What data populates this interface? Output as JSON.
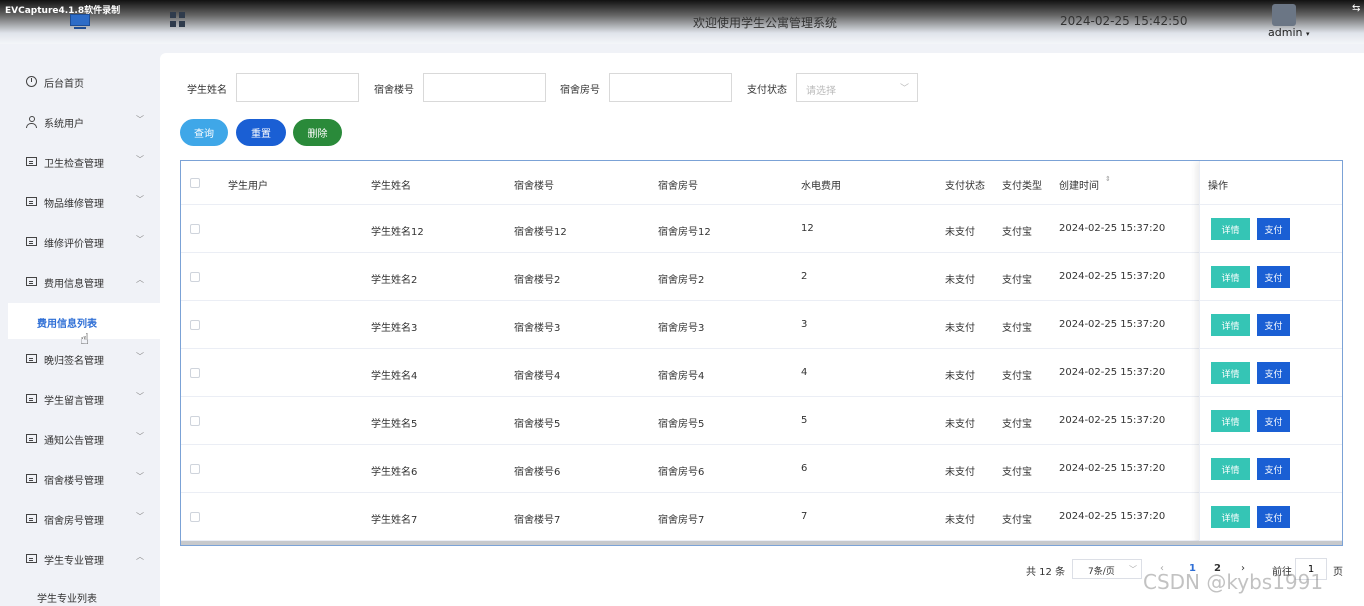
{
  "header": {
    "recorder_label": "EVCapture4.1.8软件录制",
    "title": "欢迎使用学生公寓管理系统",
    "datetime": "2024-02-25 15:42:50",
    "user": "admin",
    "user_caret": "▾"
  },
  "sidebar": {
    "items": [
      {
        "label": "后台首页",
        "icon": "clock-icon",
        "arrow": ""
      },
      {
        "label": "系统用户",
        "icon": "user-icon",
        "arrow": "﹀"
      },
      {
        "label": "卫生检查管理",
        "icon": "card-icon",
        "arrow": "﹀"
      },
      {
        "label": "物品维修管理",
        "icon": "card-icon",
        "arrow": "﹀"
      },
      {
        "label": "维修评价管理",
        "icon": "card-icon",
        "arrow": "﹀"
      },
      {
        "label": "费用信息管理",
        "icon": "card-icon",
        "arrow": "︿"
      },
      {
        "label": "晚归签名管理",
        "icon": "card-icon",
        "arrow": "﹀"
      },
      {
        "label": "学生留言管理",
        "icon": "card-icon",
        "arrow": "﹀"
      },
      {
        "label": "通知公告管理",
        "icon": "card-icon",
        "arrow": "﹀"
      },
      {
        "label": "宿舍楼号管理",
        "icon": "card-icon",
        "arrow": "﹀"
      },
      {
        "label": "宿舍房号管理",
        "icon": "card-icon",
        "arrow": "﹀"
      },
      {
        "label": "学生专业管理",
        "icon": "card-icon",
        "arrow": "︿"
      }
    ],
    "active_sub": "费用信息列表",
    "last_sub": "学生专业列表"
  },
  "filters": {
    "student_name_label": "学生姓名",
    "building_label": "宿舍楼号",
    "room_label": "宿舍房号",
    "pay_status_label": "支付状态",
    "pay_status_placeholder": "请选择",
    "student_name_value": "",
    "building_value": "",
    "room_value": ""
  },
  "buttons": {
    "search": "查询",
    "reset": "重置",
    "delete": "删除"
  },
  "table": {
    "columns": [
      "学生用户",
      "学生姓名",
      "宿舍楼号",
      "宿舍房号",
      "水电费用",
      "支付状态",
      "支付类型",
      "创建时间",
      "操作"
    ],
    "sort_glyph": "⇕",
    "detail_label": "详情",
    "pay_label": "支付",
    "rows": [
      {
        "user": "",
        "name": "学生姓名12",
        "building": "宿舍楼号12",
        "room": "宿舍房号12",
        "fee": "12",
        "status": "未支付",
        "type": "支付宝",
        "created": "2024-02-25 15:37:20"
      },
      {
        "user": "",
        "name": "学生姓名2",
        "building": "宿舍楼号2",
        "room": "宿舍房号2",
        "fee": "2",
        "status": "未支付",
        "type": "支付宝",
        "created": "2024-02-25 15:37:20"
      },
      {
        "user": "",
        "name": "学生姓名3",
        "building": "宿舍楼号3",
        "room": "宿舍房号3",
        "fee": "3",
        "status": "未支付",
        "type": "支付宝",
        "created": "2024-02-25 15:37:20"
      },
      {
        "user": "",
        "name": "学生姓名4",
        "building": "宿舍楼号4",
        "room": "宿舍房号4",
        "fee": "4",
        "status": "未支付",
        "type": "支付宝",
        "created": "2024-02-25 15:37:20"
      },
      {
        "user": "",
        "name": "学生姓名5",
        "building": "宿舍楼号5",
        "room": "宿舍房号5",
        "fee": "5",
        "status": "未支付",
        "type": "支付宝",
        "created": "2024-02-25 15:37:20"
      },
      {
        "user": "",
        "name": "学生姓名6",
        "building": "宿舍楼号6",
        "room": "宿舍房号6",
        "fee": "6",
        "status": "未支付",
        "type": "支付宝",
        "created": "2024-02-25 15:37:20"
      },
      {
        "user": "",
        "name": "学生姓名7",
        "building": "宿舍楼号7",
        "room": "宿舍房号7",
        "fee": "7",
        "status": "未支付",
        "type": "支付宝",
        "created": "2024-02-25 15:37:20"
      }
    ]
  },
  "pagination": {
    "total": "共 12 条",
    "page_size": "7条/页",
    "prev": "‹",
    "next": "›",
    "pages": [
      "1",
      "2"
    ],
    "current_page": "1",
    "goto_label": "前往",
    "goto_value": "1",
    "page_suffix": "页"
  },
  "watermark": "CSDN @kybs1991",
  "colors": {
    "primary": "#1a5fd4",
    "search": "#3fa7e8",
    "delete": "#2a8a3a",
    "detail": "#35c5b5",
    "active_menu": "#2f6fd6"
  }
}
